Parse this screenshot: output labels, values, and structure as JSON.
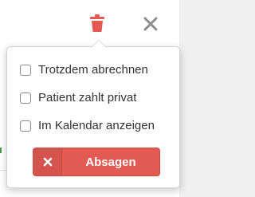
{
  "toolbar": {
    "trash_icon": "trash-icon",
    "close_icon": "close-icon",
    "trash_color": "#e35a52",
    "close_color": "#8c8c8c"
  },
  "popover": {
    "options": [
      {
        "label": "Trotzdem abrechnen",
        "checked": false
      },
      {
        "label": "Patient zahlt privat",
        "checked": false
      },
      {
        "label": "Im Kalendar anzeigen",
        "checked": false
      }
    ],
    "submit": {
      "icon": "x-icon",
      "label": "Absagen",
      "color": "#e35a52"
    }
  }
}
